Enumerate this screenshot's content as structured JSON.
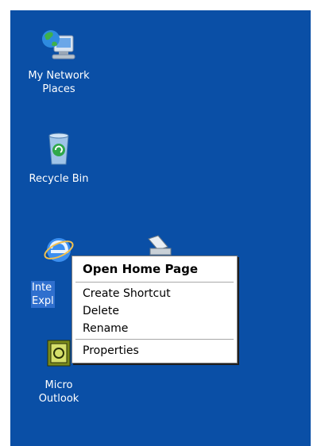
{
  "desktop": {
    "icons": [
      {
        "label": "My Network\nPlaces"
      },
      {
        "label": "Recycle Bin"
      },
      {
        "label": "Internet\nExplorer",
        "visible_label": "Inte\nExpl"
      },
      {
        "label": "Microsoft\nOutlook",
        "visible_label": "Micro\nOutlook"
      }
    ]
  },
  "context_menu": {
    "items": [
      {
        "label": "Open Home Page",
        "default": true
      },
      {
        "separator": true
      },
      {
        "label": "Create Shortcut"
      },
      {
        "label": "Delete"
      },
      {
        "label": "Rename"
      },
      {
        "separator": true
      },
      {
        "label": "Properties"
      }
    ]
  },
  "colors": {
    "desktop_bg": "#0a4fa6",
    "selection_bg": "#2f6fce",
    "menu_bg": "#ffffff"
  }
}
